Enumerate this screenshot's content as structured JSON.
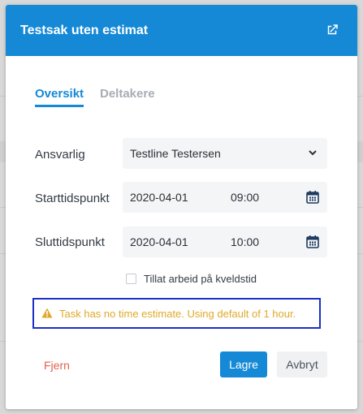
{
  "modal": {
    "title": "Testsak uten estimat",
    "header_icon": "external-link-icon"
  },
  "tabs": [
    {
      "label": "Oversikt",
      "active": true
    },
    {
      "label": "Deltakere",
      "active": false
    }
  ],
  "form": {
    "responsible": {
      "label": "Ansvarlig",
      "value": "Testline Testersen",
      "icon": "chevron-down-icon"
    },
    "start": {
      "label": "Starttidspunkt",
      "date": "2020-04-01",
      "time": "09:00",
      "icon": "calendar-icon"
    },
    "end": {
      "label": "Sluttidspunkt",
      "date": "2020-04-01",
      "time": "10:00",
      "icon": "calendar-icon"
    },
    "evening_work": {
      "label": "Tillat arbeid på kveldstid",
      "checked": false
    }
  },
  "warning": {
    "icon": "warning-icon",
    "text": "Task has no time estimate. Using default of 1 hour."
  },
  "actions": {
    "remove_label": "Fjern",
    "save_label": "Lagre",
    "cancel_label": "Avbryt"
  },
  "colors": {
    "primary": "#1589d6",
    "warning": "#e0a92a",
    "danger": "#e2614d",
    "highlight_border": "#1c2ec8"
  }
}
